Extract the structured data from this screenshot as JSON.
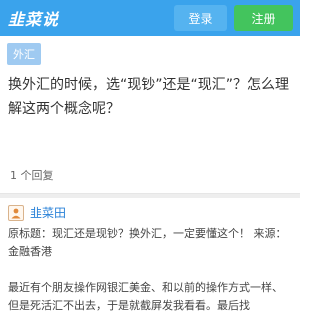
{
  "header": {
    "logo": "韭菜说",
    "login_label": "登录",
    "register_label": "注册",
    "brand_color": "#3aa3ec"
  },
  "question": {
    "tag": "外汇",
    "title": "换外汇的时候，选“现钞”还是“现汇”？怎么理解这两个概念呢？",
    "reply_count": "1 个回复"
  },
  "answer": {
    "avatar_icon": "user-avatar-icon",
    "author": "韭菜田",
    "paragraph1": "原标题：现汇还是现钞？换外汇，一定要懂这个！ 来源：金融香港",
    "paragraph2": "最近有个朋友操作网银汇美金、和以前的操作方式一样、但是死活汇不出去，于是就截屏发我看看。最后找"
  }
}
